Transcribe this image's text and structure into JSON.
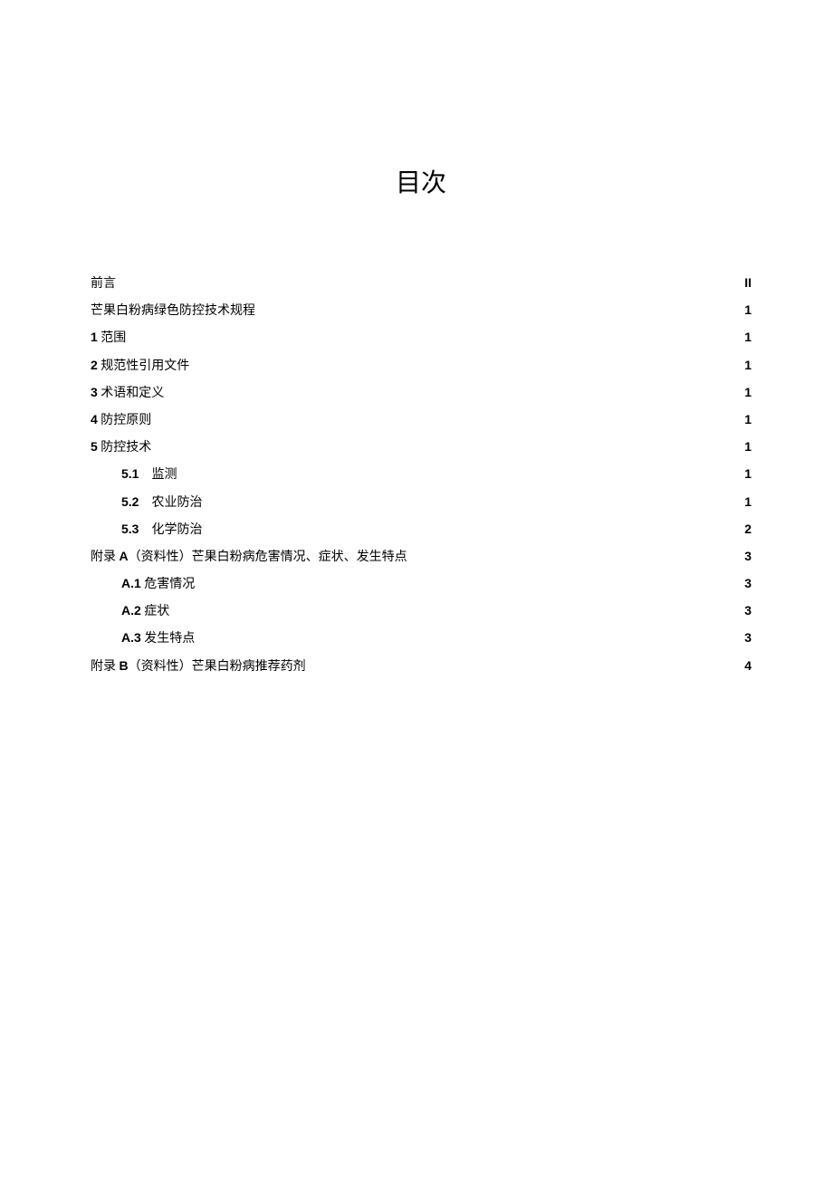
{
  "title": "目次",
  "toc": [
    {
      "num": "",
      "txt": "前言",
      "page": "II",
      "indent": false
    },
    {
      "num": "",
      "txt": "芒果白粉病绿色防控技术规程",
      "page": "1",
      "indent": false
    },
    {
      "num": "1",
      "txt": " 范围",
      "page": "1",
      "indent": false
    },
    {
      "num": "2",
      "txt": " 规范性引用文件",
      "page": "1",
      "indent": false
    },
    {
      "num": "3",
      "txt": " 术语和定义",
      "page": "1",
      "indent": false
    },
    {
      "num": "4",
      "txt": " 防控原则",
      "page": "1",
      "indent": false
    },
    {
      "num": "5",
      "txt": " 防控技术",
      "page": "1",
      "indent": false
    },
    {
      "num": "5.1",
      "txt": "　监测",
      "page": "1",
      "indent": true
    },
    {
      "num": "5.2",
      "txt": "　农业防治",
      "page": "1",
      "indent": true
    },
    {
      "num": "5.3",
      "txt": "　化学防治",
      "page": "2",
      "indent": true
    },
    {
      "num": "",
      "txt": "附录 ",
      "num2": "A",
      "txt2": "（资料性）芒果白粉病危害情况、症状、发生特点",
      "page": "3",
      "indent": false
    },
    {
      "num": "A.1",
      "txt": " 危害情况",
      "page": "3",
      "indent": true
    },
    {
      "num": "A.2",
      "txt": " 症状",
      "page": "3",
      "indent": true
    },
    {
      "num": "A.3",
      "txt": " 发生特点",
      "page": "3",
      "indent": true
    },
    {
      "num": "",
      "txt": "附录 ",
      "num2": "B",
      "txt2": "（资料性）芒果白粉病推荐药剂",
      "page": "4",
      "indent": false
    }
  ]
}
